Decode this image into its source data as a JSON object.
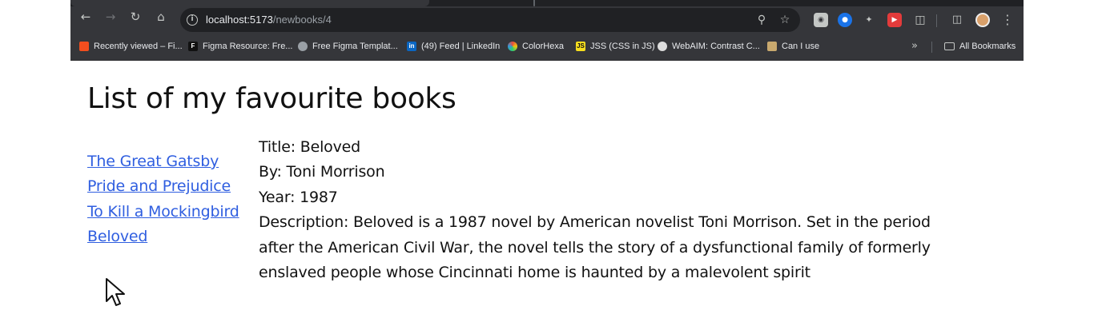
{
  "browser": {
    "url_host": "localhost:5173",
    "url_path": "/newbooks/4",
    "bookmarks": [
      {
        "label": "Recently viewed – Fi...",
        "icon": "figma-icon",
        "color": "#f24e1e"
      },
      {
        "label": "Figma Resource: Fre...",
        "icon": "figma-resource-icon",
        "color": "#111111"
      },
      {
        "label": "Free Figma Templat...",
        "icon": "globe-icon",
        "color": "#9aa0a6"
      },
      {
        "label": "(49) Feed | LinkedIn",
        "icon": "linkedin-icon",
        "color": "#0a66c2"
      },
      {
        "label": "ColorHexa",
        "icon": "colorhexa-icon",
        "color": "#e8a23a"
      },
      {
        "label": "JSS (CSS in JS)",
        "icon": "jss-icon",
        "color": "#f7df1e"
      },
      {
        "label": "WebAIM: Contrast C...",
        "icon": "webaim-icon",
        "color": "#dddddd"
      },
      {
        "label": "Can I use",
        "icon": "caniuse-icon",
        "color": "#c9a96e"
      }
    ],
    "all_bookmarks_label": "All Bookmarks"
  },
  "page": {
    "title": "List of my favourite books",
    "books": [
      {
        "title": "The Great Gatsby"
      },
      {
        "title": "Pride and Prejudice"
      },
      {
        "title": "To Kill a Mockingbird"
      },
      {
        "title": "Beloved"
      }
    ],
    "selected": {
      "title_line": "Title: Beloved",
      "author_line": "By: Toni Morrison",
      "year_line": "Year: 1987",
      "description_line": "Description: Beloved is a 1987 novel by American novelist Toni Morrison. Set in the period after the American Civil War, the novel tells the story of a dysfunctional family of formerly enslaved people whose Cincinnati home is haunted by a malevolent spirit"
    }
  }
}
